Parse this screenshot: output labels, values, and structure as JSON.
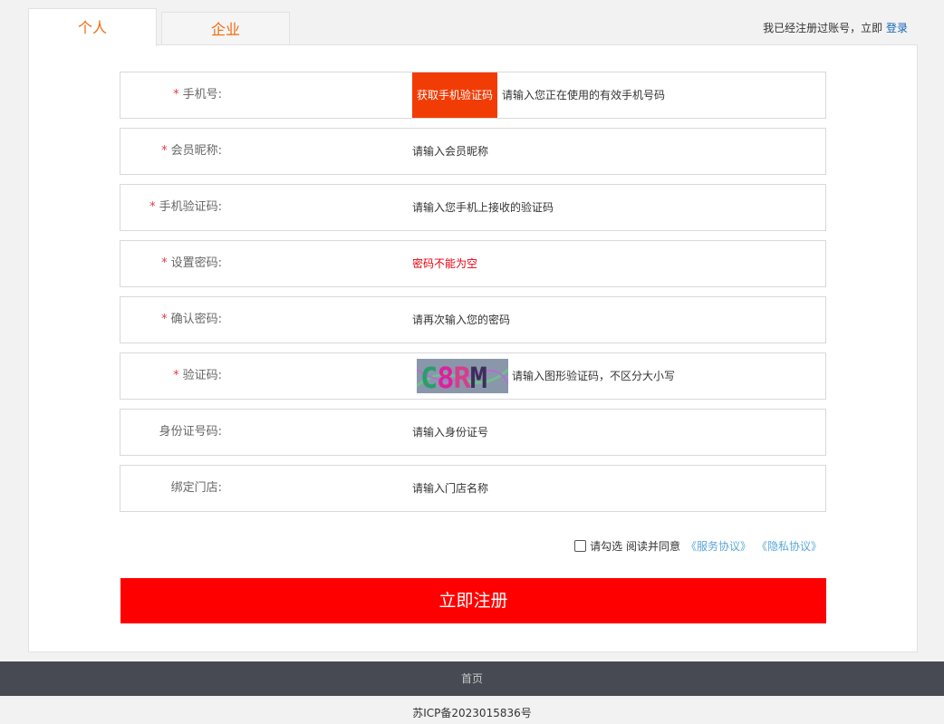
{
  "tabs": {
    "personal": "个人",
    "company": "企业"
  },
  "login_hint": {
    "text": "我已经注册过账号，立即 ",
    "link": "登录"
  },
  "fields": [
    {
      "label": "手机号:",
      "required": true,
      "sms_button": "获取手机验证码",
      "hint": "请输入您正在使用的有效手机号码"
    },
    {
      "label": "会员昵称:",
      "required": true,
      "hint": "请输入会员昵称"
    },
    {
      "label": "手机验证码:",
      "required": true,
      "hint": "请输入您手机上接收的验证码"
    },
    {
      "label": "设置密码:",
      "required": true,
      "hint": "密码不能为空",
      "error": true
    },
    {
      "label": "确认密码:",
      "required": true,
      "hint": "请再次输入您的密码"
    },
    {
      "label": "验证码:",
      "required": true,
      "captcha": "C8RM",
      "hint": "请输入图形验证码，不区分大小写"
    },
    {
      "label": "身份证号码:",
      "required": false,
      "hint": "请输入身份证号"
    },
    {
      "label": "绑定门店:",
      "required": false,
      "hint": "请输入门店名称"
    }
  ],
  "agreement": {
    "text": "请勾选 阅读并同意",
    "service": "《服务协议》",
    "privacy": "《隐私协议》"
  },
  "submit_label": "立即注册",
  "footer": {
    "nav": "首页",
    "icp": "苏ICP备2023015836号"
  },
  "colors": {
    "accent": "#f26a0e",
    "submit": "#ff0000",
    "sms_button": "#f23c05",
    "error": "#e4000e",
    "link": "#5aa7d8",
    "footer_bg": "#474a52"
  }
}
